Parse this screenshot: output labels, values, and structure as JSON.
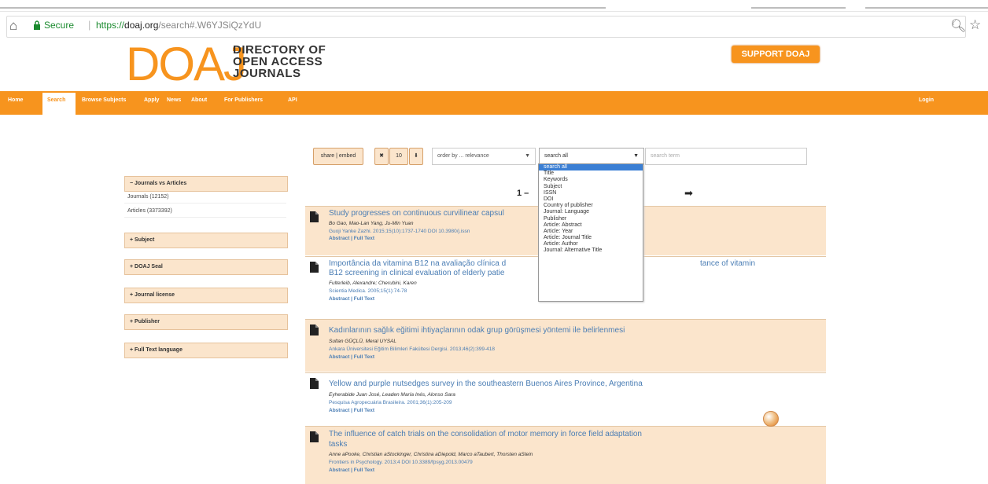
{
  "browser": {
    "secure_label": "Secure",
    "url_scheme": "https://",
    "url_host": "doaj.org",
    "url_path": "/search#.W6YJSiQzYdU"
  },
  "header": {
    "logo_text": "DOAJ",
    "logo_line1": "DIRECTORY OF",
    "logo_line2": "OPEN ACCESS",
    "logo_line3": "JOURNALS",
    "support_label": "SUPPORT DOAJ"
  },
  "nav": {
    "items": [
      "Home",
      "Search",
      "Browse Subjects",
      "Apply",
      "News",
      "About",
      "For Publishers",
      "API"
    ],
    "login": "Login"
  },
  "toolbar": {
    "share_label": "share | embed",
    "clear_label": "✖",
    "page_size": "10",
    "download_label": "⬇",
    "order_by": "order by ... relevance",
    "search_field": "search all",
    "search_placeholder": "search term"
  },
  "dropdown": {
    "options": [
      "search all",
      "Title",
      "Keywords",
      "Subject",
      "ISSN",
      "DOI",
      "Country of publisher",
      "Journal: Language",
      "Publisher",
      "Article: Abstract",
      "Article: Year",
      "Article: Journal Title",
      "Article: Author",
      "Journal: Alternative Title"
    ],
    "selected": "search all"
  },
  "pager": {
    "text": "1 –",
    "next": "➡"
  },
  "facets": {
    "journals_vs_articles": "− Journals vs Articles",
    "journals": "Journals (12152)",
    "articles": "Articles (3373392)",
    "subject": "+ Subject",
    "seal": "+ DOAJ Seal",
    "license": "+ Journal license",
    "publisher": "+ Publisher",
    "language": "+ Full Text language"
  },
  "results": [
    {
      "title": "Study progresses on continuous curvilinear capsul",
      "authors": "Bo Gao, Mao-Lan Yang, Ju-Min Yuan",
      "source": "Guoji Yanke Zazhi. 2015;15(10):1737-1740 DOI 10.3980/j.issn",
      "links": "Abstract | Full Text"
    },
    {
      "title": "Importância da vitamina B12 na avaliação clínica d",
      "title_tail": "tance of vitamin",
      "title2": "B12 screening in clinical evaluation of elderly patie",
      "authors": "Fulterleib, Alexandre; Cherubini, Karen",
      "source": "Scientia Medica. 2005;15(1):74-78",
      "links": "Abstract | Full Text"
    },
    {
      "title": "Kadınlarının sağlık eğitimi ihtiyaçlarının odak grup görüşmesi yöntemi ile belirlenmesi",
      "authors": "Sultan GÜÇLÜ, Meral UYSAL",
      "source": "Ankara Üniversitesi Eğitim Bilimleri Fakültesi Dergisi. 2013;46(2):399-418",
      "links": "Abstract | Full Text"
    },
    {
      "title": "Yellow and purple nutsedges survey in the southeastern Buenos Aires Province, Argentina",
      "authors": "Eyherabide Juan José, Leaden María Inés, Alonso Sara",
      "source": "Pesquisa Agropecuária Brasileira. 2001;36(1):205-209",
      "links": "Abstract | Full Text"
    },
    {
      "title": "The influence of catch trials on the consolidation of motor memory in force field adaptation",
      "title2": "tasks",
      "authors": "Anne aPooke, Christian aStockinger, Christina aDiepold, Marco aTaubert, Thorsten aStein",
      "source": "Frontiers in Psychology. 2013;4 DOI 10.3389/fpsyg.2013.00479",
      "links": "Abstract | Full Text"
    }
  ],
  "colors": {
    "brand_orange": "#f7941e",
    "result_bg": "#fbe5cc",
    "link_blue": "#4a7db4"
  }
}
